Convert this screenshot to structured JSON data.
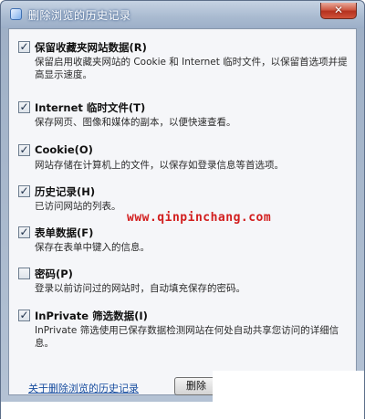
{
  "dialog": {
    "title": "删除浏览的历史记录",
    "close_glyph": "✕"
  },
  "options": [
    {
      "title": "保留收藏夹网站数据(R)",
      "desc": "保留启用收藏夹网站的 Cookie 和 Internet 临时文件，以保留首选项并提高显示速度。",
      "checked": true
    },
    {
      "title": "Internet 临时文件(T)",
      "desc": "保存网页、图像和媒体的副本，以便快速查看。",
      "checked": true
    },
    {
      "title": "Cookie(O)",
      "desc": "网站存储在计算机上的文件，以保存如登录信息等首选项。",
      "checked": true
    },
    {
      "title": "历史记录(H)",
      "desc": "已访问网站的列表。",
      "checked": true
    },
    {
      "title": "表单数据(F)",
      "desc": "保存在表单中键入的信息。",
      "checked": true
    },
    {
      "title": "密码(P)",
      "desc": "登录以前访问过的网站时，自动填充保存的密码。",
      "checked": false
    },
    {
      "title": "InPrivate 筛选数据(I)",
      "desc": "InPrivate 筛选使用已保存数据检测网站在何处自动共享您访问的详细信息。",
      "checked": true
    }
  ],
  "watermark": "www.qinpinchang.com",
  "footer": {
    "help_link": "关于删除浏览的历史记录",
    "delete_button": "删除"
  },
  "icons": {
    "checkbox_checked": "check-icon"
  }
}
